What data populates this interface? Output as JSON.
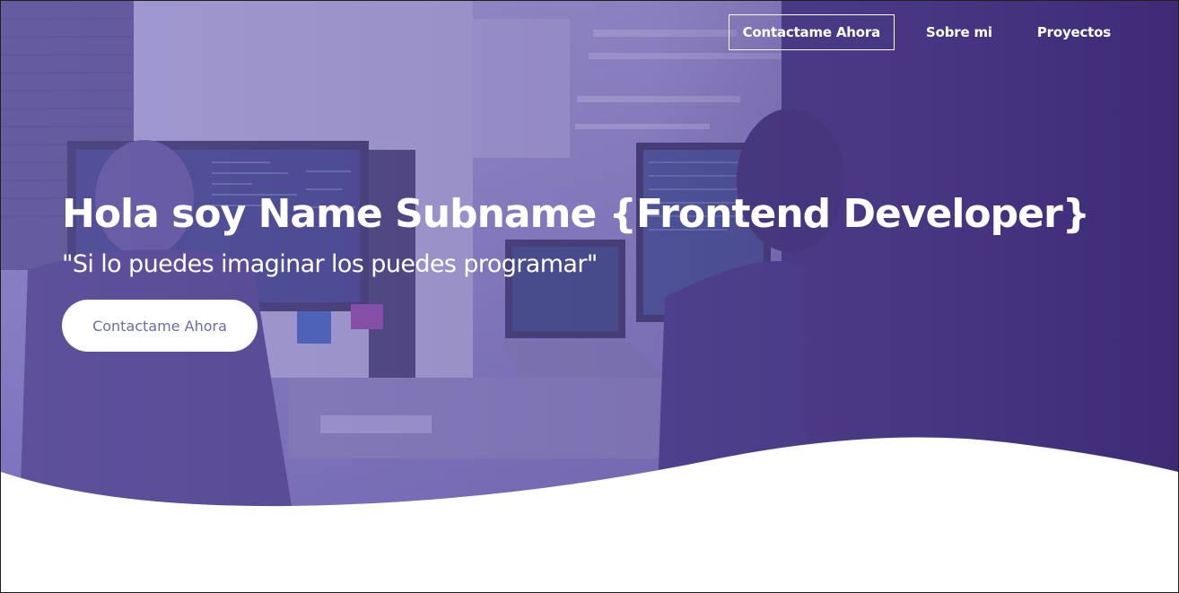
{
  "nav": {
    "items": [
      {
        "label": "Contactame Ahora"
      },
      {
        "label": "Sobre mi"
      },
      {
        "label": "Proyectos"
      }
    ]
  },
  "hero": {
    "title": "Hola soy Name Subname {Frontend Developer}",
    "subtitle": "\"Si lo puedes imaginar los puedes programar\"",
    "cta_label": "Contactame Ahora"
  },
  "colors": {
    "overlay": "#4a3c86",
    "accent_text": "#6a6cab",
    "white": "#ffffff"
  },
  "icons": {
    "background": "office-photo-background"
  }
}
